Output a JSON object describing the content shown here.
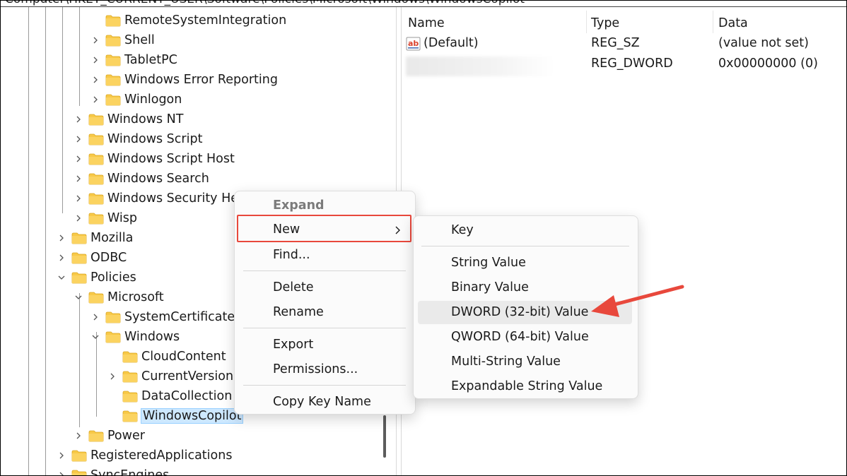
{
  "address_bar": {
    "path": "Computer\\HKEY_CURRENT_USER\\Software\\Policies\\Microsoft\\Windows\\WindowsCopilot"
  },
  "tree": {
    "items": [
      {
        "label": "RemoteSystemIntegration",
        "expander": "none"
      },
      {
        "label": "Shell",
        "expander": "collapsed"
      },
      {
        "label": "TabletPC",
        "expander": "collapsed"
      },
      {
        "label": "Windows Error Reporting",
        "expander": "collapsed"
      },
      {
        "label": "Winlogon",
        "expander": "collapsed"
      },
      {
        "label": "Windows NT",
        "expander": "collapsed"
      },
      {
        "label": "Windows Script",
        "expander": "collapsed"
      },
      {
        "label": "Windows Script Host",
        "expander": "collapsed"
      },
      {
        "label": "Windows Search",
        "expander": "collapsed"
      },
      {
        "label": "Windows Security Hea",
        "expander": "collapsed"
      },
      {
        "label": "Wisp",
        "expander": "collapsed"
      },
      {
        "label": "Mozilla",
        "expander": "collapsed"
      },
      {
        "label": "ODBC",
        "expander": "collapsed"
      },
      {
        "label": "Policies",
        "expander": "expanded"
      },
      {
        "label": "Microsoft",
        "expander": "expanded"
      },
      {
        "label": "SystemCertificates",
        "expander": "collapsed"
      },
      {
        "label": "Windows",
        "expander": "expanded"
      },
      {
        "label": "CloudContent",
        "expander": "none"
      },
      {
        "label": "CurrentVersion",
        "expander": "collapsed"
      },
      {
        "label": "DataCollection",
        "expander": "none"
      },
      {
        "label": "WindowsCopilot",
        "expander": "none",
        "selected": true
      },
      {
        "label": "Power",
        "expander": "collapsed"
      },
      {
        "label": "RegisteredApplications",
        "expander": "collapsed"
      },
      {
        "label": "SyncEngines",
        "expander": "collapsed"
      }
    ]
  },
  "values_list": {
    "columns": {
      "name": "Name",
      "type": "Type",
      "data": "Data"
    },
    "rows": [
      {
        "name": "(Default)",
        "type": "REG_SZ",
        "data": "(value not set)",
        "icon": "string-value-icon"
      },
      {
        "name": "",
        "type": "REG_DWORD",
        "data": "0x00000000 (0)",
        "icon": "dword-value-icon"
      }
    ]
  },
  "context_menu": {
    "expand": "Expand",
    "new": "New",
    "find": "Find...",
    "delete": "Delete",
    "rename": "Rename",
    "export": "Export",
    "permissions": "Permissions...",
    "copy_key_name": "Copy Key Name"
  },
  "new_submenu": {
    "key": "Key",
    "string_value": "String Value",
    "binary_value": "Binary Value",
    "dword_value": "DWORD (32-bit) Value",
    "qword_value": "QWORD (64-bit) Value",
    "multi_string_value": "Multi-String Value",
    "expandable_string_value": "Expandable String Value"
  },
  "colors": {
    "highlight_box": "#e8483c",
    "annotation_arrow": "#e8483c",
    "folder": "#f8c948",
    "selection": "#cde8ff"
  }
}
